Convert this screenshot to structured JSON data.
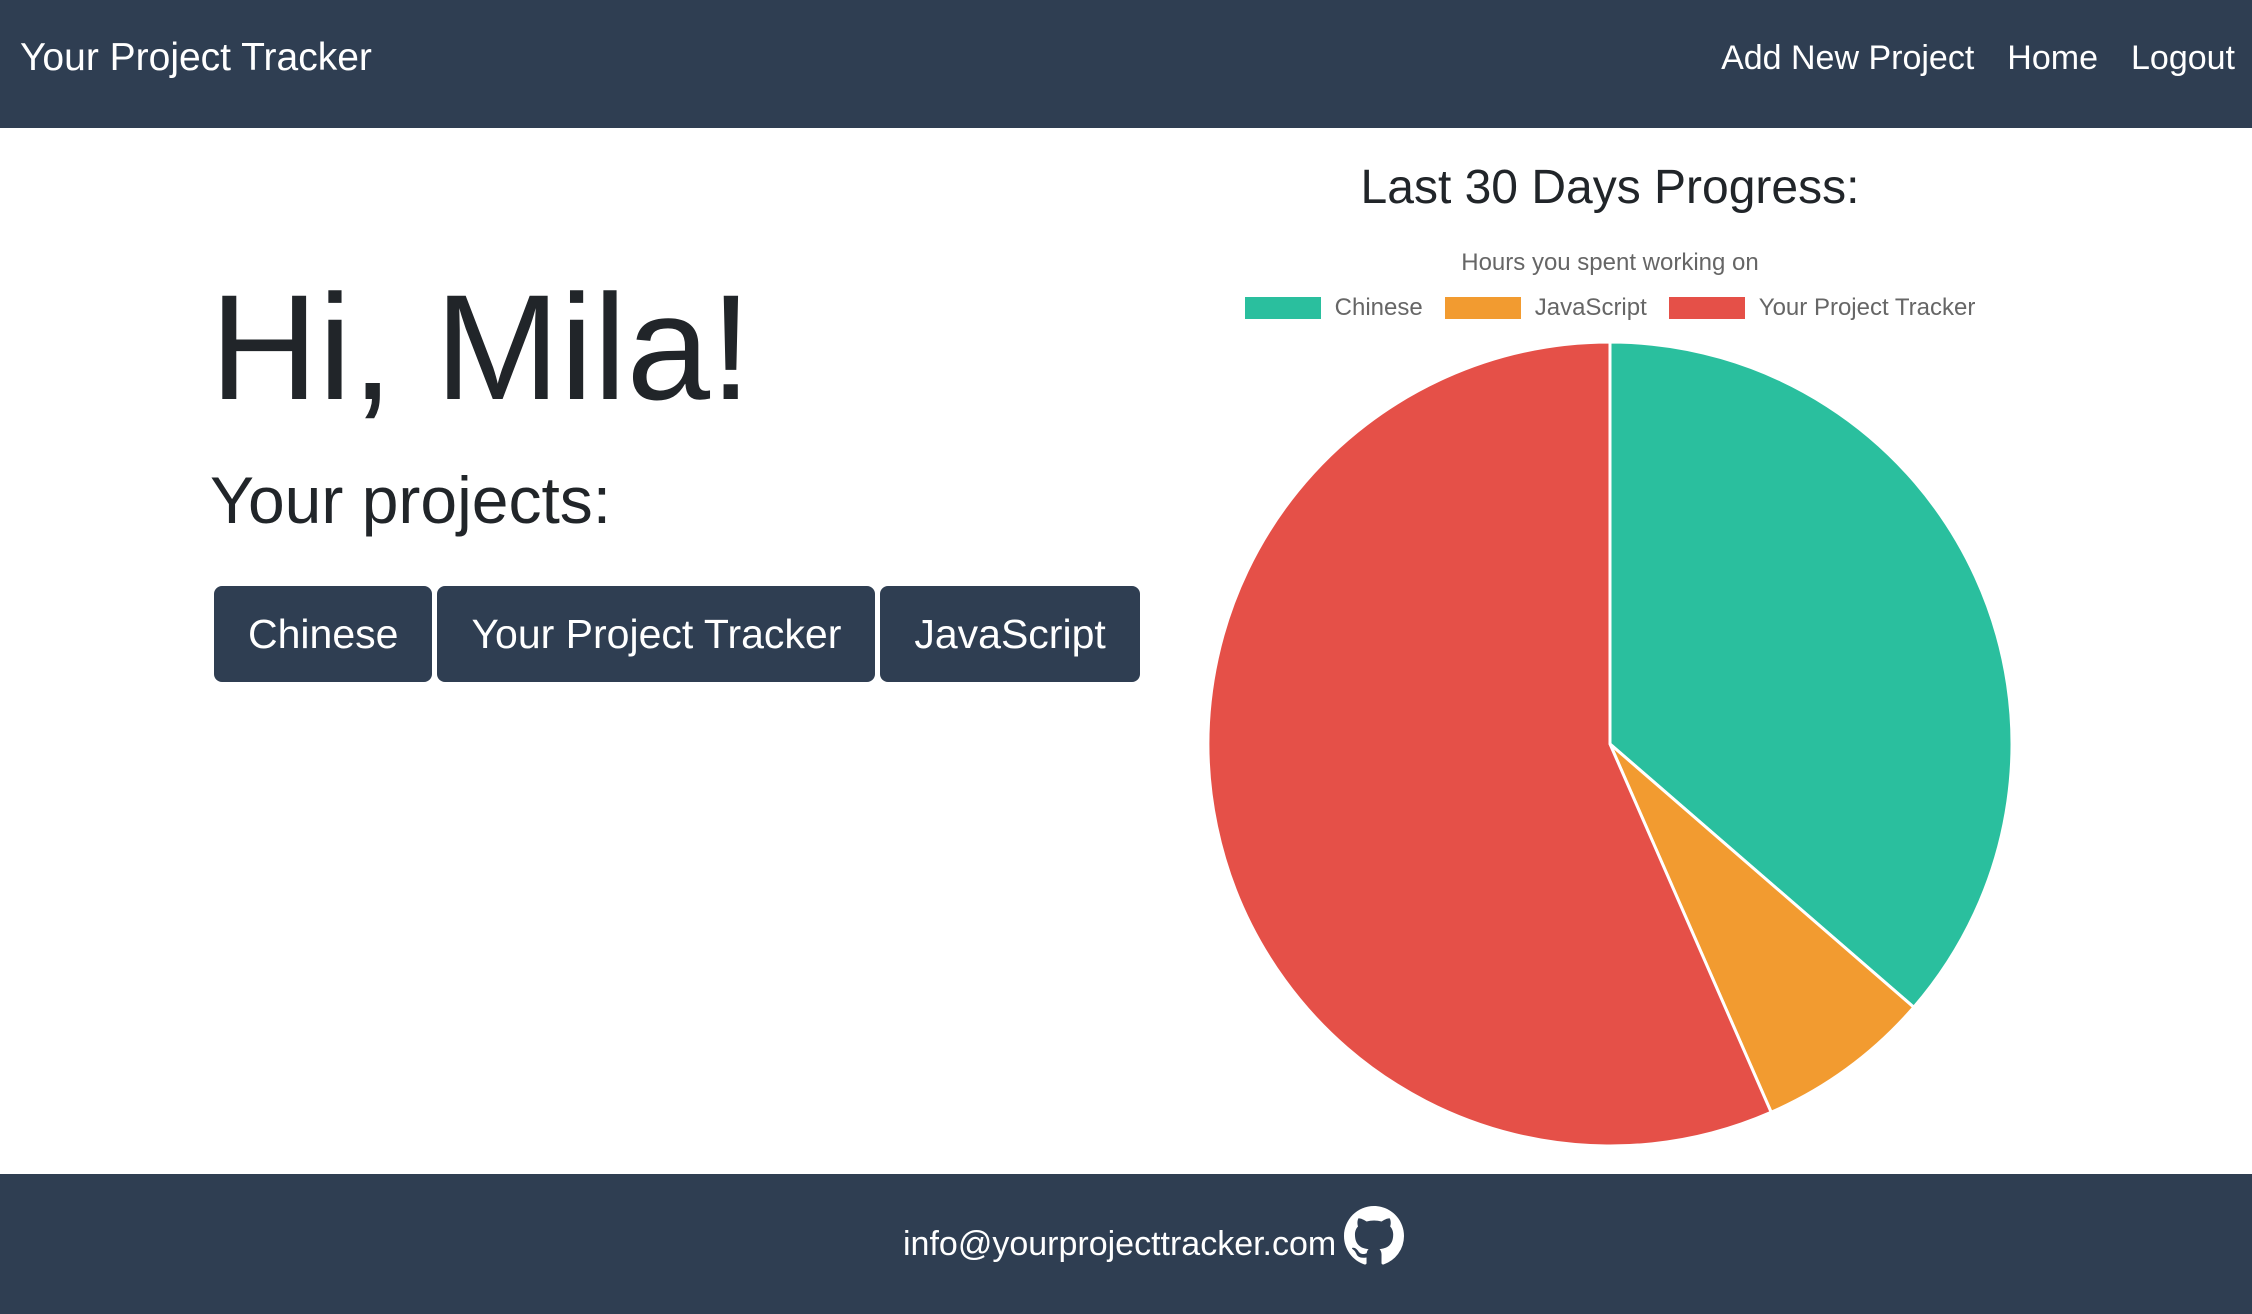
{
  "navbar": {
    "brand": "Your Project Tracker",
    "links": [
      {
        "label": "Add New Project"
      },
      {
        "label": "Home"
      },
      {
        "label": "Logout"
      }
    ]
  },
  "main": {
    "greeting": "Hi, Mila!",
    "projects_heading": "Your projects:",
    "projects": [
      {
        "label": "Chinese"
      },
      {
        "label": "Your Project Tracker"
      },
      {
        "label": "JavaScript"
      }
    ]
  },
  "chart_section": {
    "heading": "Last 30 Days Progress:"
  },
  "chart_data": {
    "type": "pie",
    "title": "Hours you spent working on",
    "legend_position": "top",
    "categories": [
      "Chinese",
      "JavaScript",
      "Your Project Tracker"
    ],
    "values": [
      36,
      7,
      56
    ],
    "colors": [
      "#2abf9e",
      "#f29b30",
      "#e55048"
    ],
    "border_color": "#ffffff",
    "start_angle": "top"
  },
  "footer": {
    "email": "info@yourprojecttracker.com",
    "icon": "github-icon"
  }
}
